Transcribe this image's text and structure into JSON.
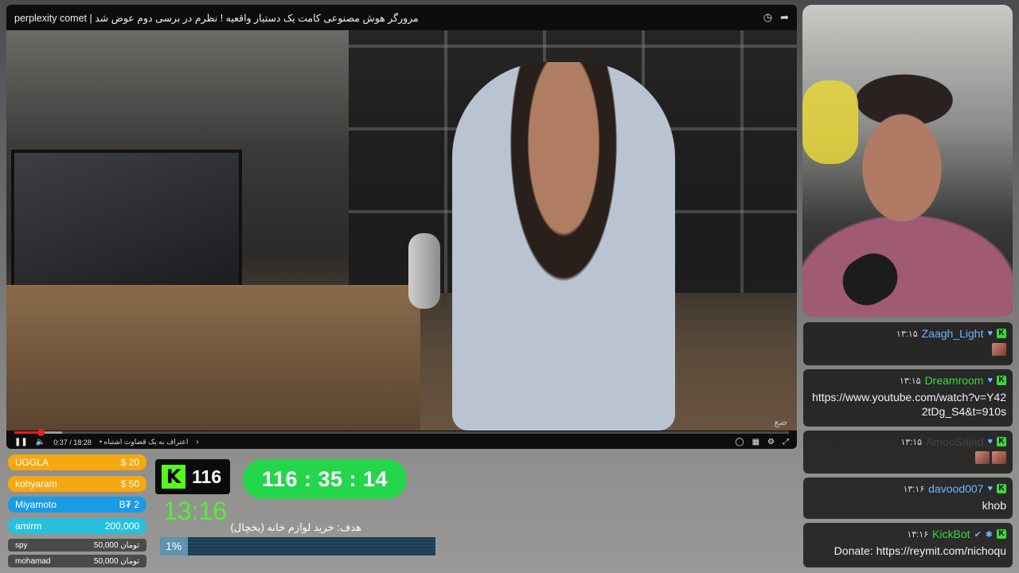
{
  "video": {
    "title": "مرورگر هوش مصنوعی کامت یک دستیار واقعیه ! نظرم در برسی دوم عوض شد | perplexity comet",
    "icons": {
      "history": "clock-icon",
      "share": "share-icon"
    },
    "watermark": "ضع",
    "player": {
      "current_time": "0:37",
      "separator": "/",
      "duration": "18:28",
      "chapter": "اعتراف به یک قضاوت اشتباه •",
      "played_fraction": 0.034,
      "buffered_fraction": 0.062
    }
  },
  "chat": {
    "messages": [
      {
        "user": "Zaagh_Light",
        "user_color": "#6fb6ff",
        "time": "۱۳:۱۵",
        "body": "",
        "emotes": 1
      },
      {
        "user": "Dreamroom",
        "user_color": "#3bd83b",
        "time": "۱۳:۱۵",
        "body": "https://www.youtube.com/watch?v=Y422tDg_S4&t=910s",
        "emotes": 0
      },
      {
        "user": "AmooSajad",
        "user_color": "#444444",
        "time": "۱۳:۱۵",
        "body": "",
        "emotes": 2
      },
      {
        "user": "davood007",
        "user_color": "#6fb6ff",
        "time": "۱۳:۱۶",
        "body": "khob",
        "emotes": 0
      },
      {
        "user": "KickBot",
        "user_color": "#3bd83b",
        "time": "۱۳:۱۶",
        "body": "Donate: https://reymit.com/nichoqu",
        "emotes": 0
      }
    ]
  },
  "donors": [
    {
      "name": "UGGLA",
      "amount": "$ 20",
      "color": "#f5a810"
    },
    {
      "name": "kohyaram",
      "amount": "$ 50",
      "color": "#f5a810"
    },
    {
      "name": "Miyamoto",
      "amount": "B₮ 2",
      "color": "#1a9be6"
    },
    {
      "name": "amirm",
      "amount": "200,000",
      "color": "#27c0dd"
    },
    {
      "name": "spy",
      "amount": "50,000 تومان",
      "color": "#4a4a4a"
    },
    {
      "name": "mohamad",
      "amount": "50,000 تومان",
      "color": "#4a4a4a"
    }
  ],
  "kick": {
    "logo": "K",
    "followers": "116",
    "brand_color": "#53fc18"
  },
  "clock": "13:16",
  "timer": "116 : 35 : 14",
  "goal": {
    "label": "هدف: خرید لوازم خانه (یخچال)",
    "percent_text": "1%",
    "percent": 1
  }
}
